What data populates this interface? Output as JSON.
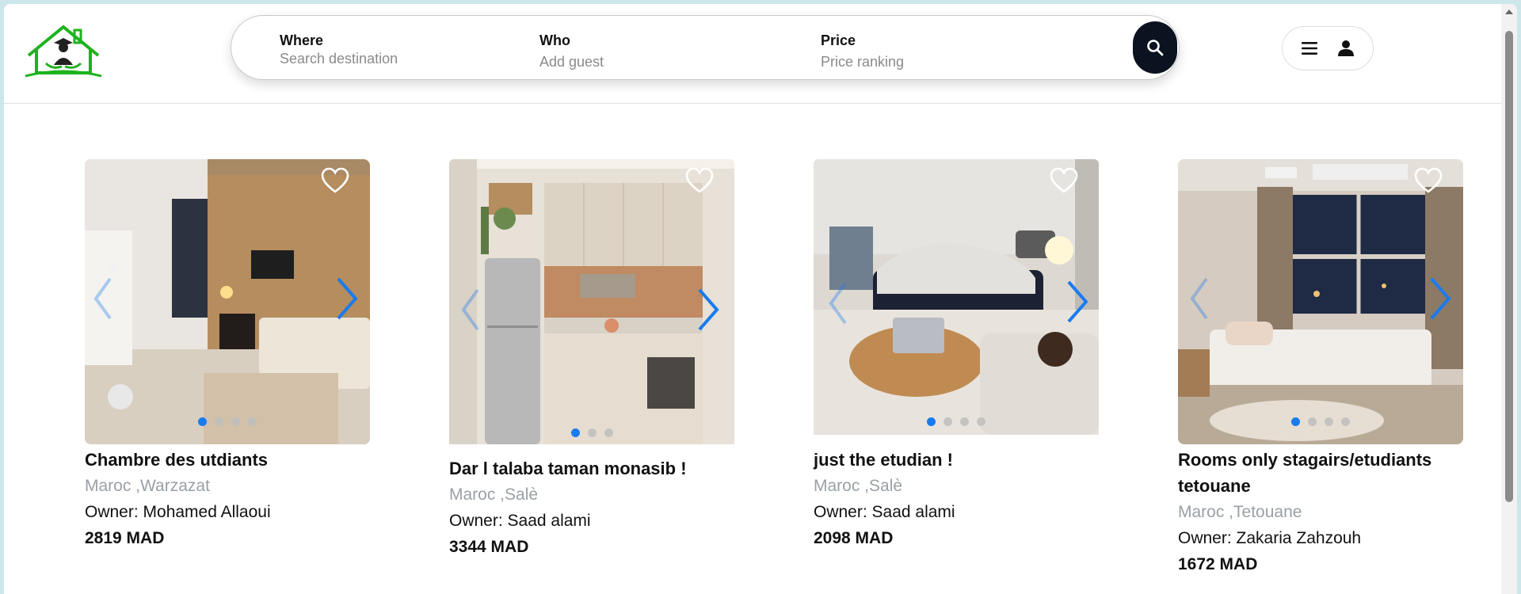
{
  "search": {
    "where_label": "Where",
    "where_placeholder": "Search destination",
    "who_label": "Who",
    "who_hint": "Add guest",
    "price_label": "Price",
    "price_hint": "Price ranking"
  },
  "icons": {
    "logo": "house-graduate-logo",
    "search": "search-icon",
    "menu": "hamburger-icon",
    "user": "user-icon",
    "favorite": "heart-outline-icon",
    "prev": "chevron-left-icon",
    "next": "chevron-right-icon"
  },
  "colors": {
    "accent": "#1a7bef",
    "logo_green": "#1db31d",
    "search_button": "#0b1220",
    "muted_text": "#9aa0a6"
  },
  "listings": [
    {
      "title": "Chambre des utdiants",
      "location": "Maroc ,Warzazat",
      "owner": "Owner: Mohamed Allaoui",
      "price": "2819 MAD"
    },
    {
      "title": "Dar l talaba taman monasib !",
      "location": "Maroc ,Salè",
      "owner": "Owner: Saad alami",
      "price": "3344 MAD"
    },
    {
      "title": "just the etudian !",
      "location": "Maroc ,Salè",
      "owner": "Owner: Saad alami",
      "price": "2098 MAD"
    },
    {
      "title": "Rooms only stagairs/etudiants tetouane",
      "location": "Maroc ,Tetouane",
      "owner": "Owner: Zakaria Zahzouh",
      "price": "1672 MAD"
    }
  ]
}
